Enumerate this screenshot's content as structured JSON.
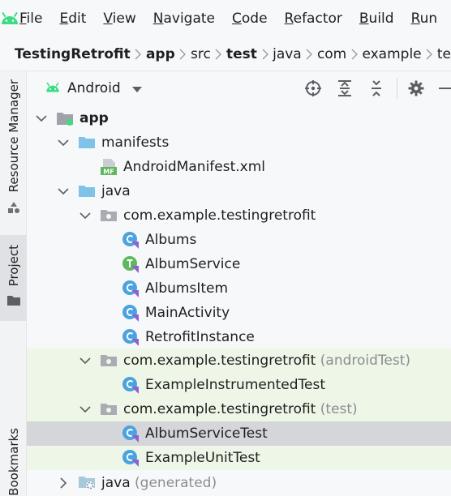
{
  "menu": {
    "items": [
      {
        "first": "F",
        "rest": "ile"
      },
      {
        "first": "E",
        "rest": "dit"
      },
      {
        "first": "V",
        "rest": "iew"
      },
      {
        "first": "N",
        "rest": "avigate"
      },
      {
        "first": "C",
        "rest": "ode"
      },
      {
        "first": "R",
        "rest": "efactor"
      },
      {
        "first": "B",
        "rest": "uild"
      },
      {
        "first": "R",
        "rest": "un"
      }
    ]
  },
  "breadcrumb": [
    "TestingRetrofit",
    "app",
    "src",
    "test",
    "java",
    "com",
    "example",
    "te"
  ],
  "toolstrip": {
    "resource_manager": "Resource Manager",
    "project": "Project",
    "bookmarks": "Bookmarks"
  },
  "panel": {
    "title": "Android"
  },
  "tree": {
    "app": "app",
    "manifests": "manifests",
    "manifest_file": "AndroidManifest.xml",
    "manifest_badge": "MF",
    "java": "java",
    "pkg_main": "com.example.testingretrofit",
    "classes_main": [
      "Albums",
      "AlbumService",
      "AlbumsItem",
      "MainActivity",
      "RetrofitInstance"
    ],
    "pkg_android_test": "com.example.testingretrofit",
    "pkg_android_test_suffix": "(androidTest)",
    "class_android_test": "ExampleInstrumentedTest",
    "pkg_test": "com.example.testingretrofit",
    "pkg_test_suffix": "(test)",
    "classes_test": [
      "AlbumServiceTest",
      "ExampleUnitTest"
    ],
    "java_generated": "java",
    "java_generated_suffix": "(generated)"
  },
  "colors": {
    "android_green": "#3ddc84",
    "folder_blue": "#7fc4e8",
    "class_blue": "#4aa3df",
    "interface_green": "#5fb85f",
    "kotlin_purple": "#8a63d2",
    "test_row_bg": "#eef6e7",
    "selected_row_bg": "#d5d6d9"
  }
}
